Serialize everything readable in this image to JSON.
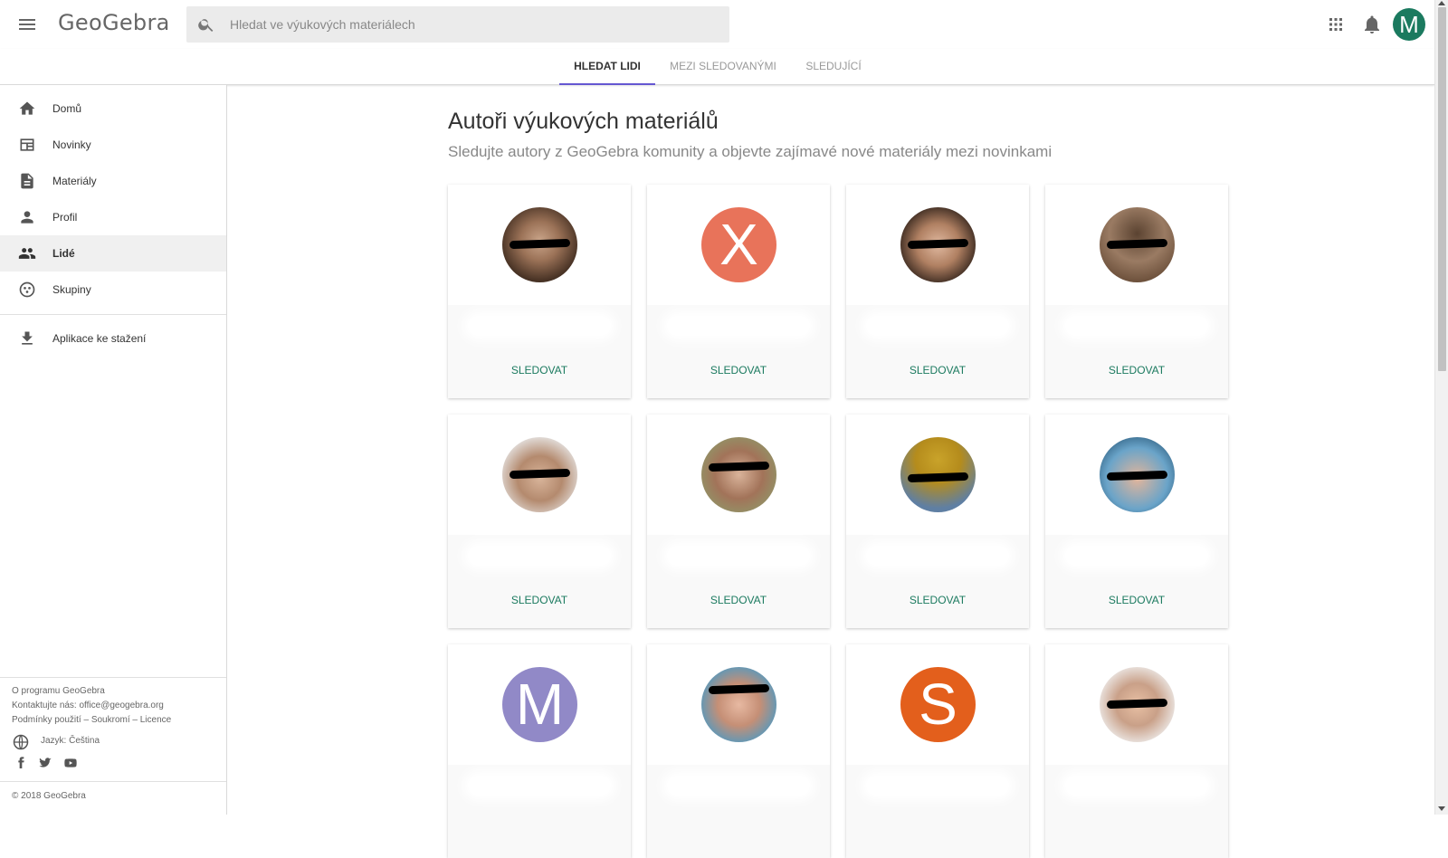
{
  "header": {
    "app_name": "GeoGebra",
    "search_placeholder": "Hledat ve výukových materiálech",
    "user_initial": "M",
    "icons": [
      "menu-icon",
      "search-icon",
      "apps-grid-icon",
      "notifications-bell-icon"
    ]
  },
  "tabs": [
    {
      "label": "HLEDAT LIDI",
      "active": true
    },
    {
      "label": "MEZI SLEDOVANÝMI",
      "active": false
    },
    {
      "label": "SLEDUJÍCÍ",
      "active": false
    }
  ],
  "sidebar": {
    "items": [
      {
        "label": "Domů",
        "icon": "home-icon"
      },
      {
        "label": "Novinky",
        "icon": "news-icon"
      },
      {
        "label": "Materiály",
        "icon": "document-icon"
      },
      {
        "label": "Profil",
        "icon": "person-icon"
      },
      {
        "label": "Lidé",
        "icon": "people-icon",
        "active": true
      },
      {
        "label": "Skupiny",
        "icon": "groups-icon"
      }
    ],
    "download": {
      "label": "Aplikace ke stažení",
      "icon": "download-icon"
    },
    "footer": {
      "about": "O programu GeoGebra",
      "contact": "Kontaktujte nás: office@geogebra.org",
      "legal": "Podmínky použití – Soukromí – Licence",
      "language": "Jazyk: Čeština",
      "copyright": "© 2018 GeoGebra",
      "social_icons": [
        "facebook-icon",
        "twitter-icon",
        "youtube-icon"
      ]
    }
  },
  "main": {
    "title": "Autoři výukových materiálů",
    "subtitle": "Sledujte autory z GeoGebra komunity a objevte zajímavé nové materiály mezi novinkami",
    "follow_label": "SLEDOVAT",
    "cards": [
      {
        "avatar": "photo"
      },
      {
        "avatar": "letter",
        "letter": "X",
        "color": "#e8735a"
      },
      {
        "avatar": "photo"
      },
      {
        "avatar": "photo"
      },
      {
        "avatar": "photo"
      },
      {
        "avatar": "photo"
      },
      {
        "avatar": "photo"
      },
      {
        "avatar": "photo"
      },
      {
        "avatar": "letter",
        "letter": "M",
        "color": "#9189c7"
      },
      {
        "avatar": "photo"
      },
      {
        "avatar": "letter",
        "letter": "S",
        "color": "#e35f1c"
      },
      {
        "avatar": "photo"
      }
    ]
  },
  "colors": {
    "accent": "#6557d2",
    "follow": "#1b7a5f",
    "avatar_top": "#1b7a5f"
  }
}
